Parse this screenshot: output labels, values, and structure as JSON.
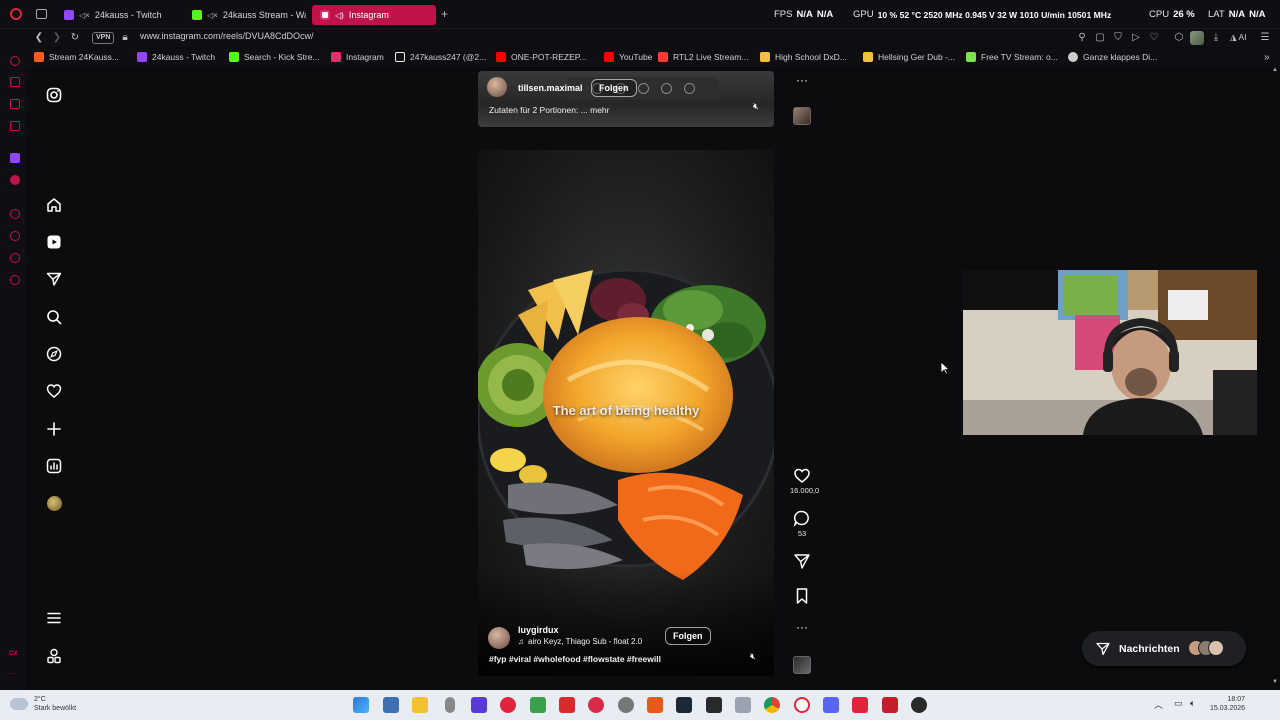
{
  "browser": {
    "tabs": [
      {
        "label": "24kauss - Twitch",
        "muted": true,
        "color": "#9146ff"
      },
      {
        "label": "24kauss Stream - Wa",
        "muted": true,
        "color": "#53fc18"
      },
      {
        "label": "Instagram",
        "muted": false,
        "color": "#e1306c",
        "active": true
      }
    ],
    "new_tab_symbol": "+",
    "url": "www.instagram.com/reels/DVUA8CdDOcw/",
    "vpn_label": "VPN",
    "stats": {
      "fps_label": "FPS",
      "fps_value": "N/A",
      "fps_value2": "N/A",
      "gpu_label": "GPU",
      "gpu_values": "10 %  52 °C  2520 MHz  0.945 V  32 W  1010 U/min  10501 MHz",
      "cpu_label": "CPU",
      "cpu_value": "26 %",
      "lat_label": "LAT",
      "lat_value": "N/A",
      "lat_value2": "N/A"
    },
    "bookmarks": [
      {
        "label": "Stream 24Kauss...",
        "color": "#ff5a1f"
      },
      {
        "label": "24kauss - Twitch",
        "color": "#9146ff"
      },
      {
        "label": "Search - Kick Stre...",
        "color": "#53fc18"
      },
      {
        "label": "Instagram",
        "color": "#e1306c"
      },
      {
        "label": "247kauss247 (@2...",
        "color": "#ffffff"
      },
      {
        "label": "ONE-POT-REZEP...",
        "color": "#ff0000"
      },
      {
        "label": "YouTube",
        "color": "#ff0000"
      },
      {
        "label": "RTL2 Live Stream...",
        "color": "#ff3b2f"
      },
      {
        "label": "High School DxD...",
        "color": "#f0c040"
      },
      {
        "label": "Hellsing Ger Dub -...",
        "color": "#f0c040"
      },
      {
        "label": "Free TV Stream: o...",
        "color": "#7ee04a"
      },
      {
        "label": "Ganze klappes Di...",
        "color": "#cccccc"
      }
    ],
    "ai_label": "AI"
  },
  "instagram": {
    "reel_top": {
      "username": "tillsen.maximal",
      "follow_label": "Folgen",
      "caption": "Zutaten für 2 Portionen: ... mehr"
    },
    "reel_main": {
      "overlay_text": "The art of being healthy",
      "username": "luygirdux",
      "audio": "airo Keyz, Thiago Sub - float 2.0",
      "follow_label": "Folgen",
      "hashtags": "#fyp #viral #wholefood #flowstate #freewill",
      "likes": "16.000,0",
      "comments": "53"
    },
    "messages_label": "Nachrichten"
  },
  "taskbar": {
    "weather_temp": "2°C",
    "weather_desc": "Stark bewölkt",
    "time": "18:07",
    "date": "15.03.2026"
  },
  "colors": {
    "opera_red": "#c0134a",
    "ig_bg": "#0c0c0e"
  }
}
